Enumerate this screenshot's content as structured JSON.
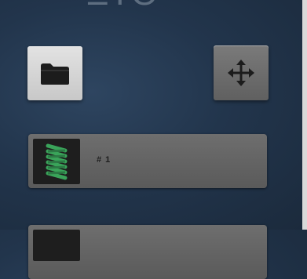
{
  "header": {
    "partial_text": "ΞΙΘ"
  },
  "toolbar": {
    "folder_icon": "folder-icon",
    "move_icon": "move-arrows-icon"
  },
  "list": {
    "items": [
      {
        "label": "# 1",
        "thumbnail": "green-spring-thumbnail"
      },
      {
        "label": "",
        "thumbnail": "dark-thumbnail"
      }
    ]
  },
  "colors": {
    "background": "#22354c",
    "accent_green": "#3aa45a",
    "button_light": "#d6d6d6",
    "button_dark": "#6a6a6a"
  }
}
